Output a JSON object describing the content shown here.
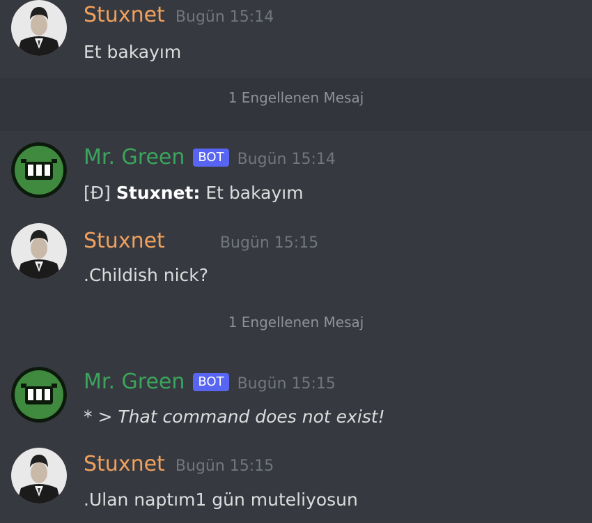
{
  "messages": [
    {
      "author": "Stuxnet",
      "timestamp": "Bugün 15:14",
      "text": "Et bakayım"
    },
    {
      "author": "Mr. Green",
      "bot_tag": "BOT",
      "timestamp": "Bugün 15:14",
      "prefix": "[Đ]",
      "quoted_author": "Stuxnet:",
      "text": "Et bakayım"
    },
    {
      "author": "Stuxnet",
      "timestamp": "Bugün 15:15",
      "text": ".Childish nick?"
    },
    {
      "author": "Mr. Green",
      "bot_tag": "BOT",
      "timestamp": "Bugün 15:15",
      "prefix": "*",
      "text": "> That command does not exist!"
    },
    {
      "author": "Stuxnet",
      "timestamp": "Bugün 15:15",
      "text": ".Ulan naptım1  gün muteliyosun"
    }
  ],
  "blocked": [
    {
      "label": "1 Engellenen Mesaj"
    },
    {
      "label": "1 Engellenen Mesaj"
    }
  ],
  "colors": {
    "background": "#36393f",
    "user_name": "#f0a15e",
    "bot_name": "#3ba55c",
    "bot_tag": "#5865f2",
    "timestamp": "#72767d"
  },
  "icons": {
    "user_avatar": "portrait-avatar",
    "bot_avatar": "green-grin-avatar"
  }
}
